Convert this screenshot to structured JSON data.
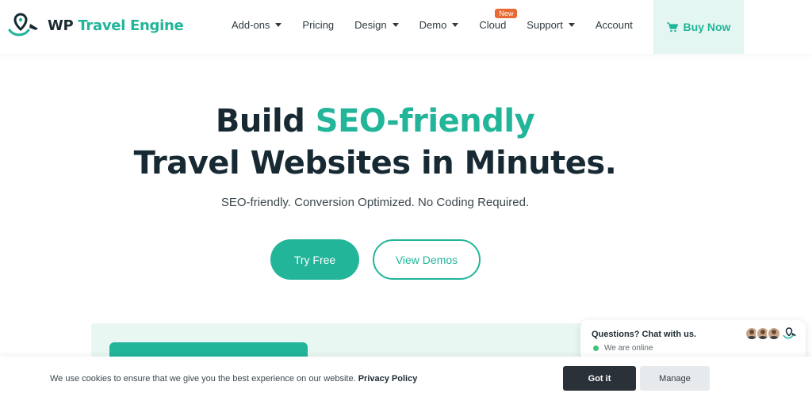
{
  "brand": {
    "prefix": "WP",
    "name": "Travel Engine",
    "accent_color": "#22b59a",
    "dark_color": "#172a33"
  },
  "nav": {
    "items": [
      {
        "label": "Add-ons",
        "has_dropdown": true
      },
      {
        "label": "Pricing",
        "has_dropdown": false
      },
      {
        "label": "Design",
        "has_dropdown": true
      },
      {
        "label": "Demo",
        "has_dropdown": true
      },
      {
        "label": "Cloud",
        "has_dropdown": false,
        "badge": "New"
      },
      {
        "label": "Support",
        "has_dropdown": true
      },
      {
        "label": "Account",
        "has_dropdown": false
      }
    ],
    "buy_now": {
      "label": "Buy Now",
      "icon": "cart-icon"
    }
  },
  "hero": {
    "title_part1": "Build ",
    "title_accent": "SEO-friendly",
    "title_line2": "Travel Websites in Minutes.",
    "subtitle": "SEO-friendly. Conversion Optimized. No Coding Required.",
    "primary_cta": "Try Free",
    "secondary_cta": "View Demos"
  },
  "chat": {
    "title": "Questions? Chat with us.",
    "status": "We are online",
    "status_color": "#3bc57a"
  },
  "cookie": {
    "message": "We use cookies to ensure that we give you the best experience on our website.",
    "policy_link": "Privacy Policy",
    "accept_label": "Got it",
    "manage_label": "Manage"
  }
}
